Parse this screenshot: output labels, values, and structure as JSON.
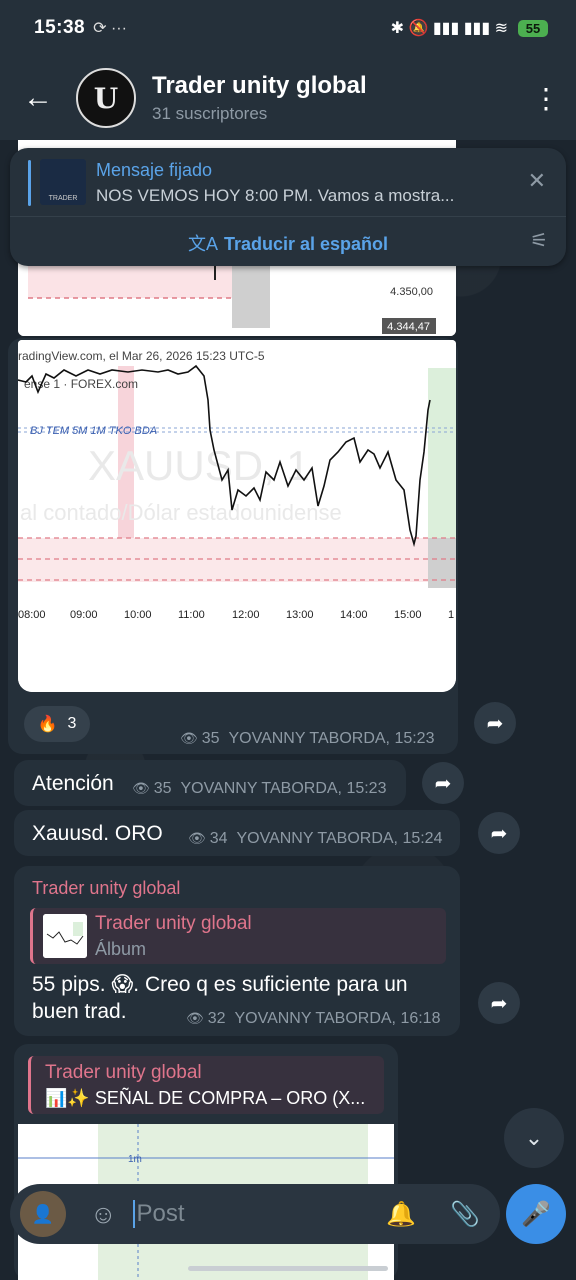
{
  "status_bar": {
    "time": "15:38",
    "left_icons": "⟳ ···",
    "right_icons": "✱ 🔕 ▮▮▮ ▮▮▮ ≋",
    "battery": "55"
  },
  "header": {
    "title": "Trader unity global",
    "subscribers": "31 suscriptores",
    "logo_letter": "U"
  },
  "pinned": {
    "title": "Mensaje fijado",
    "text": "NOS VEMOS HOY 8:00 PM.  Vamos a mostra...",
    "thumb_label": "TRADER",
    "translate_label": "Traducir al español"
  },
  "top_chart": {
    "price1": "4.350,00",
    "price2": "4.344,47"
  },
  "main_chart": {
    "source": "radingView.com, el Mar 26, 2026 15:23 UTC-5",
    "symbol_line": "ense 1 · FOREX.com",
    "legend": "BJ TEM 5M 1M    TKO  BDA",
    "watermark": "XAUUSD, 1",
    "watermark_sub": "al contado/Dólar estadounidense",
    "x_ticks": [
      "08:00",
      "09:00",
      "10:00",
      "11:00",
      "12:00",
      "13:00",
      "14:00",
      "15:00",
      "1"
    ]
  },
  "reaction": {
    "emoji": "🔥",
    "count": "3"
  },
  "messages": [
    {
      "id": "photo",
      "views": "35",
      "author": "YOVANNY TABORDA, 15:23"
    },
    {
      "id": "atencion",
      "text": "Atención",
      "views": "35",
      "author": "YOVANNY TABORDA, 15:23"
    },
    {
      "id": "xauusd",
      "text": "Xauusd.   ORO",
      "views": "34",
      "author": "YOVANNY TABORDA, 15:24"
    },
    {
      "id": "pips",
      "forwarded_from": "Trader unity global",
      "quote_name": "Trader unity global",
      "quote_sub": "Álbum",
      "text_line1": "55 pips. 😱.  Creo q es suficiente para un",
      "text_line2": "buen trad.",
      "views": "32",
      "author": "YOVANNY TABORDA, 16:18"
    },
    {
      "id": "senal",
      "quote_name": "Trader unity global",
      "quote_text": "📊✨ SEÑAL DE COMPRA – ORO (X..."
    }
  ],
  "lower_chart": {
    "label": "1m"
  },
  "composer": {
    "placeholder": "Post"
  },
  "colors": {
    "accent": "#5aa3e8",
    "bubble": "#25303a",
    "forward_name": "#e0758c",
    "mic": "#3a8ee6"
  }
}
